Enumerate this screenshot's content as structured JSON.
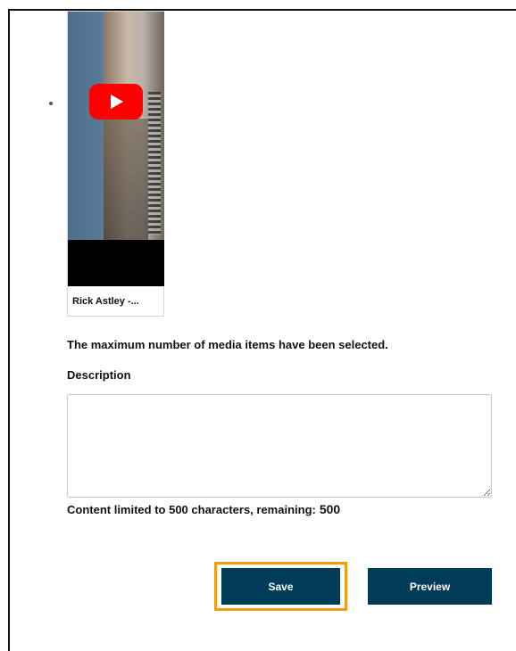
{
  "media": {
    "title": "Rick Astley -...",
    "icon": "youtube-play-icon",
    "colors": {
      "play_button": "#ff0000"
    }
  },
  "notice": "The maximum number of media items have been selected.",
  "description": {
    "label": "Description",
    "value": "",
    "placeholder": ""
  },
  "limit": {
    "text": "Content limited to 500 characters, remaining:",
    "remaining": "500"
  },
  "actions": {
    "save_label": "Save",
    "preview_label": "Preview",
    "colors": {
      "button_bg": "#003b57",
      "focus_ring": "#f39c12"
    }
  }
}
